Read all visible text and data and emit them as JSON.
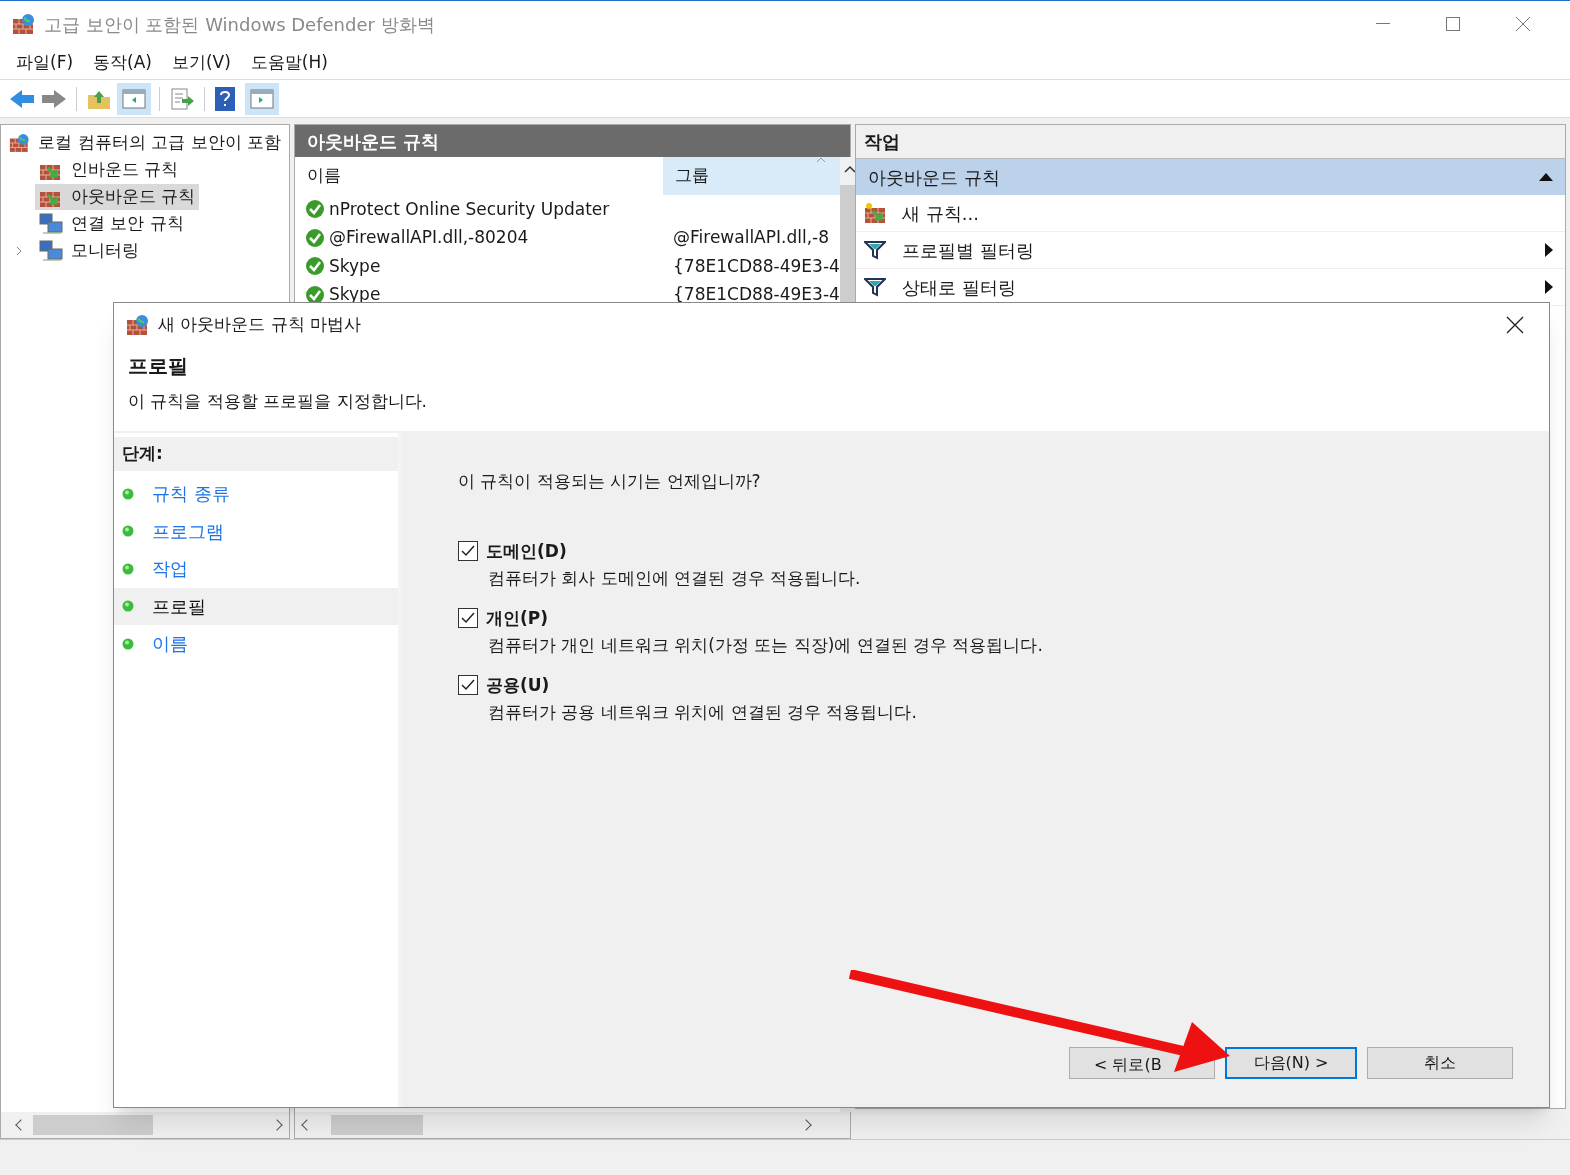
{
  "window": {
    "title": "고급 보안이 포함된 Windows Defender 방화벽"
  },
  "menu": [
    "파일(F)",
    "동작(A)",
    "보기(V)",
    "도움말(H)"
  ],
  "tree": {
    "label": "로컬 컴퓨터의 고급 보안이 포함",
    "children": [
      {
        "label": "인바운드 규칙",
        "selected": false,
        "expandable": false
      },
      {
        "label": "아웃바운드 규칙",
        "selected": true,
        "expandable": false
      },
      {
        "label": "연결 보안 규칙",
        "selected": false,
        "expandable": false
      },
      {
        "label": "모니터링",
        "selected": false,
        "expandable": true
      }
    ]
  },
  "rules_panel": {
    "title": "아웃바운드 규칙",
    "columns": [
      "이름",
      "그룹"
    ],
    "rows": [
      {
        "name": "nProtect Online Security Updater",
        "group": ""
      },
      {
        "name": "@FirewallAPI.dll,-80204",
        "group": "@FirewallAPI.dll,-8"
      },
      {
        "name": "Skype",
        "group": "{78E1CD88-49E3-4"
      },
      {
        "name": "Skype",
        "group": "{78E1CD88-49E3-4"
      }
    ]
  },
  "actions_panel": {
    "title": "작업",
    "section": {
      "label": "아웃바운드 규칙",
      "expanded": true
    },
    "items": [
      {
        "label": "새 규칙...",
        "kind": "rule",
        "submenu": false
      },
      {
        "label": "프로필별 필터링",
        "kind": "filter",
        "submenu": true
      },
      {
        "label": "상태로 필터링",
        "kind": "filter",
        "submenu": true
      }
    ]
  },
  "dialog": {
    "title": "새 아웃바운드 규칙 마법사",
    "heading": "프로필",
    "subtitle": "이 규칙을 적용할 프로필을 지정합니다.",
    "steps_label": "단계:",
    "steps": [
      {
        "label": "규칙 종류",
        "selected": false
      },
      {
        "label": "프로그램",
        "selected": false
      },
      {
        "label": "작업",
        "selected": false
      },
      {
        "label": "프로필",
        "selected": true
      },
      {
        "label": "이름",
        "selected": false
      }
    ],
    "question": "이 규칙이 적용되는 시기는 언제입니까?",
    "options": [
      {
        "label": "도메인(D)",
        "description": "컴퓨터가 회사 도메인에 연결된 경우 적용됩니다.",
        "checked": true
      },
      {
        "label": "개인(P)",
        "description": "컴퓨터가 개인 네트워크 위치(가정 또는 직장)에 연결된 경우 적용됩니다.",
        "checked": true
      },
      {
        "label": "공용(U)",
        "description": "컴퓨터가 공용 네트워크 위치에 연결된 경우 적용됩니다.",
        "checked": true
      }
    ],
    "buttons": [
      {
        "label": "< 뒤로(B",
        "default": false
      },
      {
        "label": "다음(N) >",
        "default": true
      },
      {
        "label": "취소",
        "default": false
      }
    ]
  }
}
